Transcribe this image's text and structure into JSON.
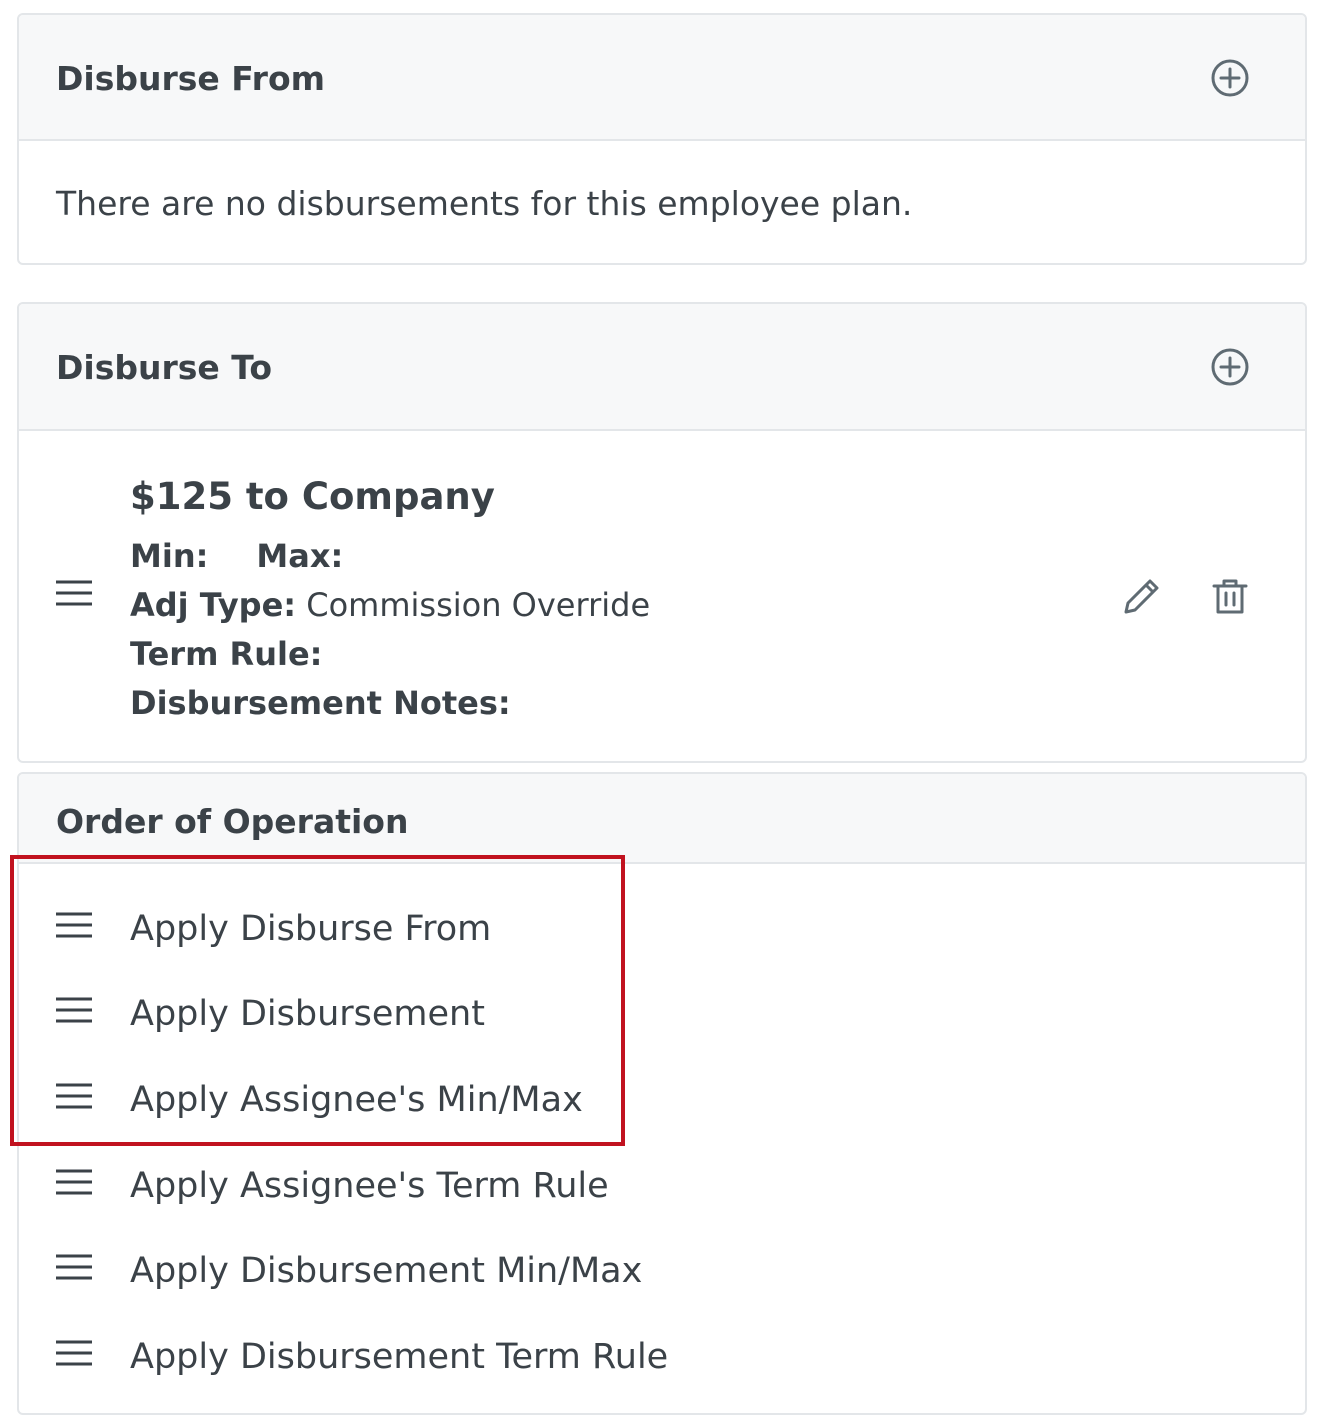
{
  "disburse_from": {
    "title": "Disburse From",
    "add_icon": "plus-circle-icon",
    "empty_message": "There are no disbursements for this employee plan."
  },
  "disburse_to": {
    "title": "Disburse To",
    "add_icon": "plus-circle-icon",
    "items": [
      {
        "title": "$125 to Company",
        "min_label": "Min:",
        "max_label": "Max:",
        "adj_type_label": "Adj Type:",
        "adj_type_value": "Commission Override",
        "term_rule_label": "Term Rule:",
        "notes_label": "Disbursement Notes:",
        "edit_icon": "pencil-icon",
        "delete_icon": "trash-icon"
      }
    ]
  },
  "order_of_operation": {
    "title": "Order of Operation",
    "items": [
      {
        "label": "Apply Disburse From"
      },
      {
        "label": "Apply Disbursement"
      },
      {
        "label": "Apply Assignee's Min/Max"
      },
      {
        "label": "Apply Assignee's Term Rule"
      },
      {
        "label": "Apply Disbursement Min/Max"
      },
      {
        "label": "Apply Disbursement Term Rule"
      }
    ]
  },
  "colors": {
    "highlight": "#c1121f",
    "text": "#3b4248",
    "header_bg": "#f7f8f9",
    "border": "#e3e6e9",
    "icon": "#5f6b73"
  }
}
